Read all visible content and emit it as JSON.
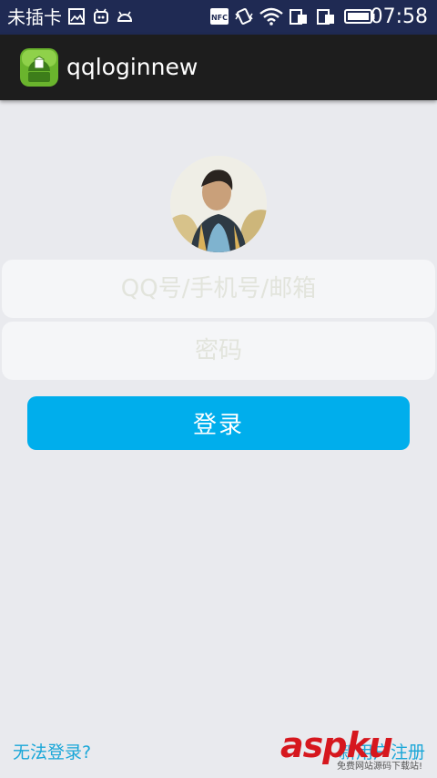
{
  "status_bar": {
    "carrier": "未插卡",
    "nfc": "NFC",
    "time": "07:58"
  },
  "action_bar": {
    "title": "qqloginnew",
    "icon": "android-app-icon"
  },
  "form": {
    "account_placeholder": "QQ号/手机号/邮箱",
    "password_placeholder": "密码",
    "login_label": "登录"
  },
  "footer": {
    "cannot_login": "无法登录?",
    "register": "新用户注册"
  },
  "watermark": {
    "main": "aspku",
    "sub": "免费网站源码下载站!"
  },
  "colors": {
    "status_bar_bg": "#1f2a53",
    "action_bar_bg": "#1d1d1d",
    "page_bg": "#e9eaee",
    "accent": "#00aeec",
    "link": "#1aa7d8"
  }
}
